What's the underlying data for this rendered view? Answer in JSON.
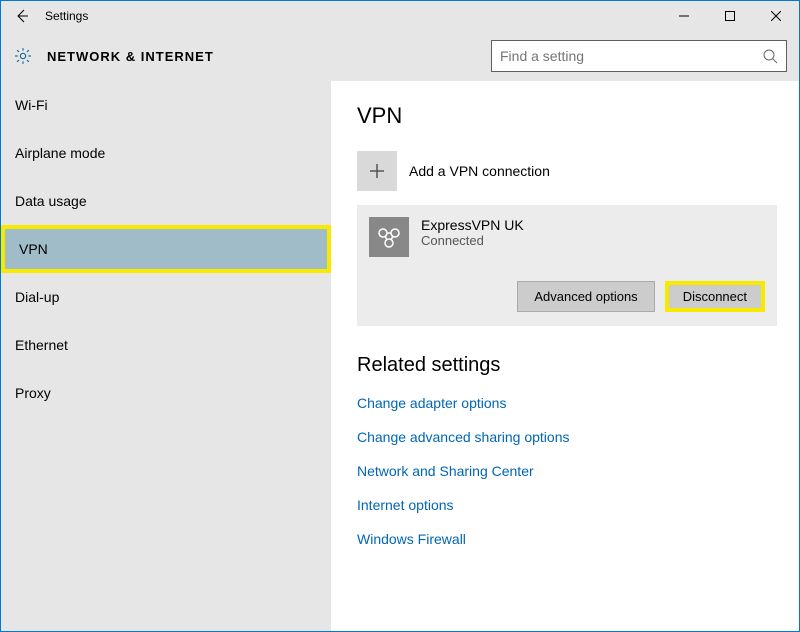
{
  "titlebar": {
    "title": "Settings"
  },
  "header": {
    "heading": "NETWORK & INTERNET",
    "search_placeholder": "Find a setting"
  },
  "sidebar": {
    "items": [
      {
        "label": "Wi-Fi",
        "selected": false
      },
      {
        "label": "Airplane mode",
        "selected": false
      },
      {
        "label": "Data usage",
        "selected": false
      },
      {
        "label": "VPN",
        "selected": true,
        "highlight": true
      },
      {
        "label": "Dial-up",
        "selected": false
      },
      {
        "label": "Ethernet",
        "selected": false
      },
      {
        "label": "Proxy",
        "selected": false
      }
    ]
  },
  "main": {
    "title": "VPN",
    "add_label": "Add a VPN connection",
    "vpn": {
      "name": "ExpressVPN UK",
      "status": "Connected",
      "advanced_label": "Advanced options",
      "disconnect_label": "Disconnect",
      "disconnect_highlight": true
    },
    "related_title": "Related settings",
    "related_links": [
      "Change adapter options",
      "Change advanced sharing options",
      "Network and Sharing Center",
      "Internet options",
      "Windows Firewall"
    ]
  }
}
